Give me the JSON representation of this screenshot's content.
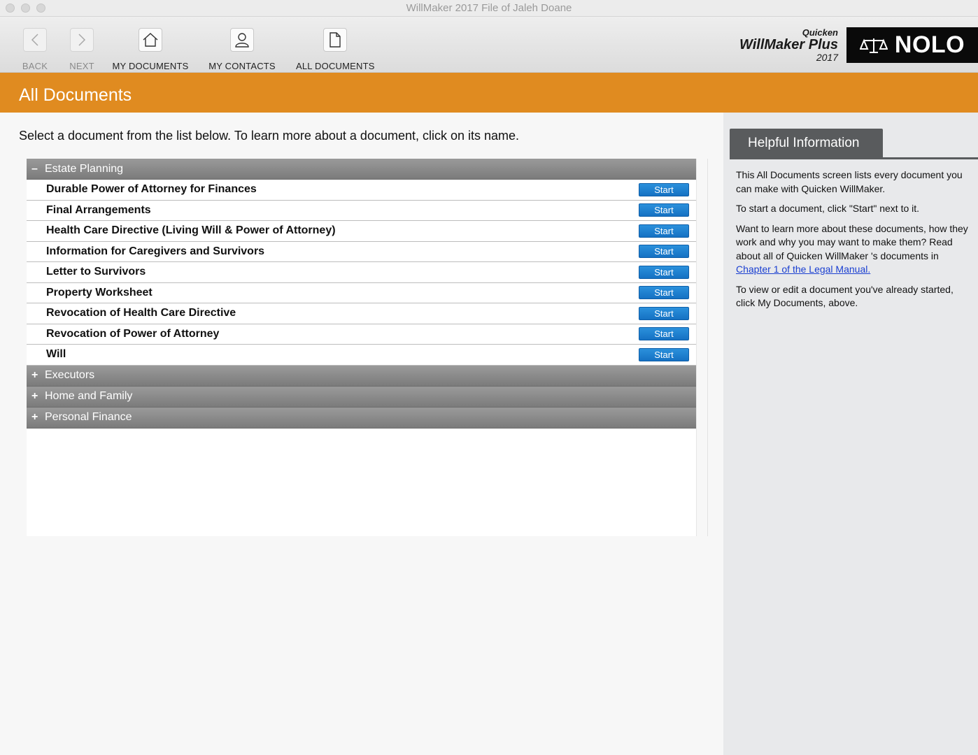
{
  "window": {
    "title": "WillMaker 2017 File of Jaleh Doane"
  },
  "toolbar": {
    "back": "BACK",
    "next": "NEXT",
    "my_documents": "MY DOCUMENTS",
    "my_contacts": "MY CONTACTS",
    "all_documents": "ALL DOCUMENTS"
  },
  "brand": {
    "line1": "Quicken",
    "line2": "WillMaker Plus",
    "line3": "2017",
    "nolo": "NOLO"
  },
  "header": {
    "title": "All Documents"
  },
  "main": {
    "instructions": "Select a document from the list below. To learn more about a document, click on its name.",
    "start_label": "Start",
    "categories": [
      {
        "sign": "–",
        "name": "Estate Planning",
        "expanded": true,
        "documents": [
          "Durable Power of Attorney for Finances",
          "Final Arrangements",
          "Health Care Directive (Living Will & Power of Attorney)",
          "Information for Caregivers and Survivors",
          "Letter to Survivors",
          "Property Worksheet",
          "Revocation of Health Care Directive",
          "Revocation of Power of Attorney",
          "Will"
        ]
      },
      {
        "sign": "+",
        "name": "Executors",
        "expanded": false
      },
      {
        "sign": "+",
        "name": "Home and Family",
        "expanded": false
      },
      {
        "sign": "+",
        "name": "Personal Finance",
        "expanded": false
      }
    ]
  },
  "side": {
    "tab": "Helpful Information",
    "p1": "This All Documents screen lists every document you can make with Quicken WillMaker.",
    "p2": "To start a document, click \"Start\" next to it.",
    "p3_text": "Want to learn more about these documents, how they work and why you may want to make them? Read about all of Quicken WillMaker 's documents in",
    "p3_link": "Chapter 1 of the Legal Manual.",
    "p4": "To view or edit a document you've already started, click My Documents, above."
  },
  "colors": {
    "accent": "#e08b20",
    "button": "#1a7fd0",
    "category_bar": "#8a8a8a",
    "tab": "#595b5d"
  }
}
